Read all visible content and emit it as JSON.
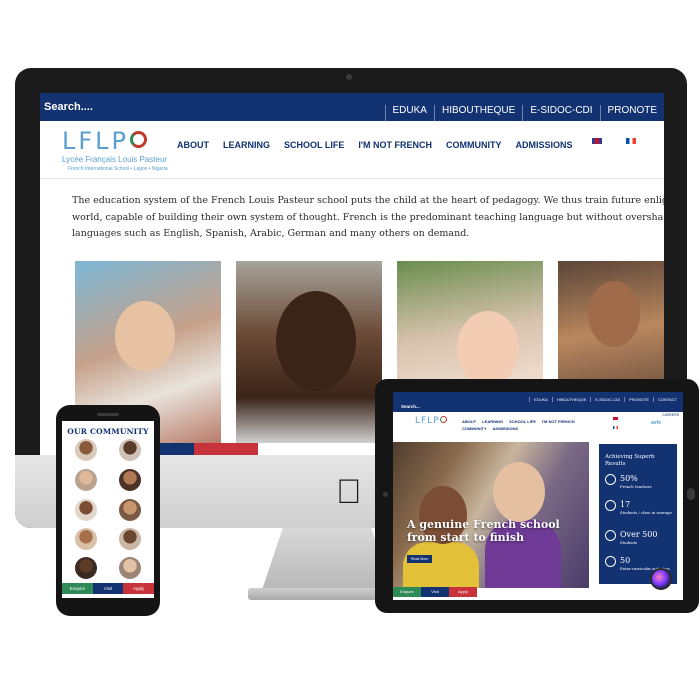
{
  "desktop": {
    "search_label": "Search....",
    "top_links": [
      "EDUKA",
      "HIBOUTHEQUE",
      "E-SIDOC-CDI",
      "PRONOTE"
    ],
    "logo_mark": "LFLP",
    "logo_name": "Lycée Français Louis Pasteur",
    "logo_sub": "French International School • Lagos • Nigeria",
    "nav": [
      "ABOUT",
      "LEARNING",
      "SCHOOL LIFE",
      "I'M NOT FRENCH",
      "COMMUNITY",
      "ADMISSIONS"
    ],
    "intro_lines": [
      "The education system of the French Louis Pasteur school puts the child at the heart of pedagogy. We thus train future enlightened and critical citizen",
      "world, capable of building their own system of thought. French is the predominant teaching language but without overshadowing the learning of ma",
      "languages such as English, Spanish, Arabic, German and many others on demand."
    ]
  },
  "tablet": {
    "search_label": "Search...",
    "top_links": [
      "EDUKA",
      "HIBOUTHEQUE",
      "E-SIDOC-CDI",
      "PRONOTE",
      "CONTACT"
    ],
    "careers": "CAREERS",
    "logo_mark": "LFLP",
    "nav": [
      "ABOUT",
      "LEARNING",
      "SCHOOL LIFE",
      "I'M NOT FRENCH",
      "COMMUNITY",
      "ADMISSIONS"
    ],
    "aefe": "aefe",
    "hero_title": "A genuine French school from start to finish",
    "read_more": "Read More",
    "stats_title": "Achieving Superb Results",
    "stats": [
      {
        "value": "50%",
        "label": "French teachers"
      },
      {
        "value": "17",
        "label": "Students / class in average"
      },
      {
        "value": "Over 500",
        "label": "Students"
      },
      {
        "value": "50",
        "label": "Extra-curricular activities"
      }
    ],
    "buttons": [
      "Enquire",
      "Visit",
      "Apply"
    ]
  },
  "phone": {
    "title": "OUR COMMUNITY",
    "buttons": [
      "Enquire",
      "Visit",
      "Apply"
    ]
  },
  "colors": {
    "navy": "#123272",
    "red": "#c7323b",
    "green": "#2e8b57",
    "logo_blue": "#5aa0cf"
  }
}
